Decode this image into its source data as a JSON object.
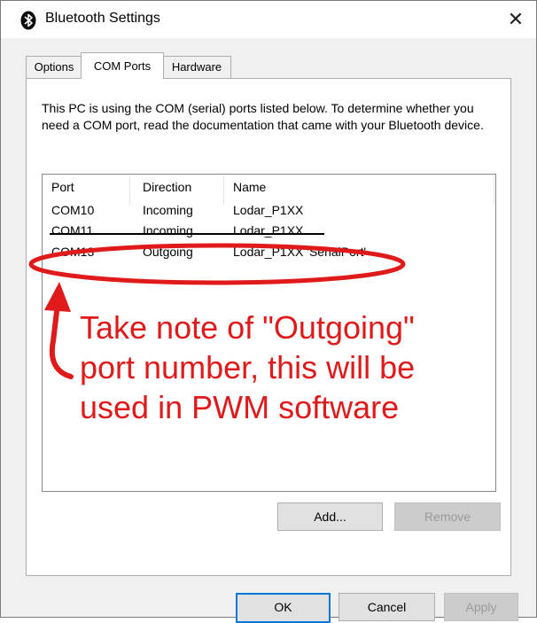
{
  "window": {
    "title": "Bluetooth Settings",
    "close_glyph": "✕"
  },
  "tabs": [
    {
      "label": "Options",
      "active": false
    },
    {
      "label": "COM Ports",
      "active": true
    },
    {
      "label": "Hardware",
      "active": false
    }
  ],
  "description": "This PC is using the COM (serial) ports listed below. To determine whether you need a COM port, read the documentation that came with your Bluetooth device.",
  "ports_table": {
    "columns": [
      "Port",
      "Direction",
      "Name"
    ],
    "rows": [
      {
        "port": "COM10",
        "direction": "Incoming",
        "name": "Lodar_P1XX"
      },
      {
        "port": "COM11",
        "direction": "Incoming",
        "name": "Lodar_P1XX"
      },
      {
        "port": "COM13",
        "direction": "Outgoing",
        "name": "Lodar_P1XX 'SerialPort'"
      }
    ]
  },
  "buttons": {
    "add": "Add...",
    "remove": "Remove",
    "ok": "OK",
    "cancel": "Cancel",
    "apply": "Apply"
  },
  "annotation": {
    "lines": [
      "Take note of \"Outgoing\"",
      "port number, this will be",
      "used in PWM software"
    ],
    "color": "#e01a1a"
  },
  "colors": {
    "accent": "#0078d7",
    "bluetooth_icon": "#0a0a0a",
    "annotation": "#e01a1a"
  },
  "icons": {
    "title": "bluetooth-icon",
    "close": "close-icon"
  }
}
